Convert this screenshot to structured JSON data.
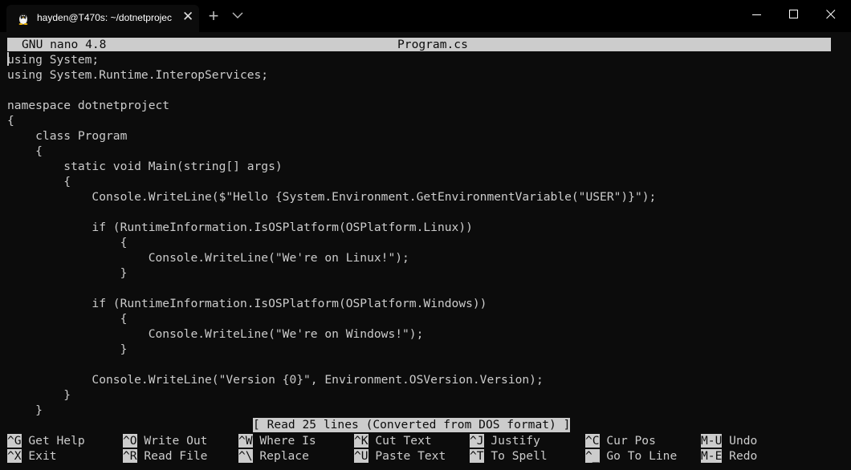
{
  "window": {
    "tab_title": "hayden@T470s: ~/dotnetprojec",
    "tab_icon": "tux-icon"
  },
  "nano": {
    "version": "GNU nano 4.8",
    "filename": "Program.cs",
    "status": "[ Read 25 lines (Converted from DOS format) ]"
  },
  "code_lines": [
    "using System;",
    "using System.Runtime.InteropServices;",
    "",
    "namespace dotnetproject",
    "{",
    "    class Program",
    "    {",
    "        static void Main(string[] args)",
    "        {",
    "            Console.WriteLine($\"Hello {System.Environment.GetEnvironmentVariable(\"USER\")}\");",
    "",
    "            if (RuntimeInformation.IsOSPlatform(OSPlatform.Linux))",
    "                {",
    "                    Console.WriteLine(\"We're on Linux!\");",
    "                }",
    "",
    "            if (RuntimeInformation.IsOSPlatform(OSPlatform.Windows))",
    "                {",
    "                    Console.WriteLine(\"We're on Windows!\");",
    "                }",
    "",
    "            Console.WriteLine(\"Version {0}\", Environment.OSVersion.Version);",
    "        }",
    "    }"
  ],
  "shortcuts": [
    {
      "key": "^G",
      "label": "Get Help"
    },
    {
      "key": "^O",
      "label": "Write Out"
    },
    {
      "key": "^W",
      "label": "Where Is"
    },
    {
      "key": "^K",
      "label": "Cut Text"
    },
    {
      "key": "^J",
      "label": "Justify"
    },
    {
      "key": "^C",
      "label": "Cur Pos"
    },
    {
      "key": "M-U",
      "label": "Undo"
    },
    {
      "key": "^X",
      "label": "Exit"
    },
    {
      "key": "^R",
      "label": "Read File"
    },
    {
      "key": "^\\",
      "label": "Replace"
    },
    {
      "key": "^U",
      "label": "Paste Text"
    },
    {
      "key": "^T",
      "label": "To Spell"
    },
    {
      "key": "^_",
      "label": "Go To Line"
    },
    {
      "key": "M-E",
      "label": "Redo"
    }
  ]
}
